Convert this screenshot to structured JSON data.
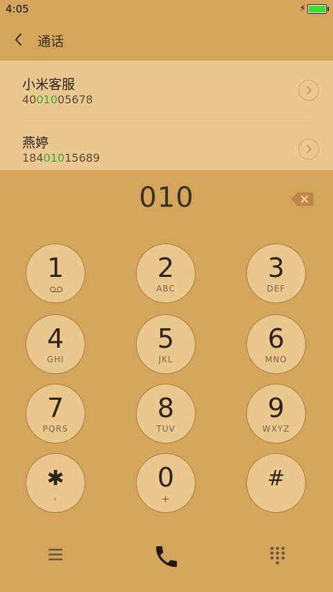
{
  "status": {
    "time": "4:05",
    "battery_level": 1.0,
    "battery_color": "#3fdc2a"
  },
  "header": {
    "title": "通话",
    "back_icon": "chevron-left-icon"
  },
  "results": [
    {
      "name": "小米客服",
      "number_prefix": "40",
      "number_match": "010",
      "number_suffix": "05678",
      "action_icon": "chevron-right-circle-icon"
    },
    {
      "name": "燕婷",
      "number_prefix": "184",
      "number_match": "010",
      "number_suffix": "15689",
      "action_icon": "chevron-right-circle-icon"
    }
  ],
  "dialer": {
    "input": "010",
    "delete_icon": "backspace-icon"
  },
  "keypad": [
    {
      "digit": "1",
      "sub": "",
      "sub_icon": "voicemail-icon"
    },
    {
      "digit": "2",
      "sub": "ABC"
    },
    {
      "digit": "3",
      "sub": "DEF"
    },
    {
      "digit": "4",
      "sub": "GHI"
    },
    {
      "digit": "5",
      "sub": "JKL"
    },
    {
      "digit": "6",
      "sub": "MNO"
    },
    {
      "digit": "7",
      "sub": "PQRS"
    },
    {
      "digit": "8",
      "sub": "TUV"
    },
    {
      "digit": "9",
      "sub": "WXYZ"
    },
    {
      "digit": "✱",
      "sub": ","
    },
    {
      "digit": "0",
      "sub": "+"
    },
    {
      "digit": "#",
      "sub": ""
    }
  ],
  "bottom_bar": {
    "menu_icon": "menu-icon",
    "call_icon": "phone-icon",
    "dialpad_icon": "dialpad-icon"
  },
  "colors": {
    "background": "#d4a55a",
    "panel": "#ecc891",
    "match_highlight": "#3aa83e"
  }
}
